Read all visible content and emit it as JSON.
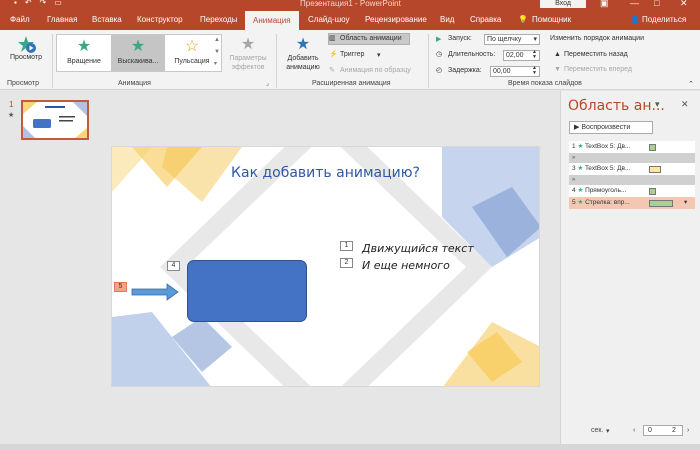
{
  "window": {
    "title": "Презентация1 - PowerPoint",
    "login": "Вход"
  },
  "tabs": [
    "Файл",
    "Главная",
    "Вставка",
    "Конструктор",
    "Переходы",
    "Анимация",
    "Слайд-шоу",
    "Рецензирование",
    "Вид",
    "Справка"
  ],
  "active_tab": "Анимация",
  "tab_right": {
    "help": "Помощник",
    "share": "Поделиться"
  },
  "ribbon": {
    "preview": {
      "label": "Просмотр",
      "group": "Просмотр"
    },
    "gallery": [
      {
        "label": "Вращение",
        "color": "#3aa68a"
      },
      {
        "label": "Выскакива...",
        "color": "#3aa68a"
      },
      {
        "label": "Пульсация",
        "color": "#d9a520"
      }
    ],
    "effect_params": "Параметры эффектов",
    "animation_group": "Анимация",
    "add_animation": "Добавить анимацию",
    "anim_pane": "Область анимации",
    "trigger": "Триггер",
    "painter": "Анимация по образцу",
    "advanced_group": "Расширенная анимация",
    "start_label": "Запуск:",
    "start_value": "По щелчку",
    "duration_label": "Длительность:",
    "duration_value": "02,00",
    "delay_label": "Задержка:",
    "delay_value": "00,00",
    "reorder": "Изменить порядок анимации",
    "move_back": "Переместить назад",
    "move_forward": "Переместить вперед",
    "timing_group": "Время показа слайдов"
  },
  "slide_panel": {
    "number": "1"
  },
  "slide": {
    "title": "Как добавить анимацию?",
    "bullets": [
      {
        "tag": "1",
        "text": "Движущийся текст"
      },
      {
        "tag": "2",
        "text": "И еще немного"
      }
    ],
    "shape_tag": "4",
    "arrow_tag": "5",
    "colors": {
      "blue": "#4472c4",
      "yellow": "#f5c242",
      "lightblue": "#8ea9db"
    }
  },
  "pane": {
    "title": "Область ан...",
    "play": "Воспроизвести",
    "items": [
      {
        "num": "1",
        "label": "TextBox 5: Дв...",
        "swatch": "#a9d18e",
        "selected": false
      },
      {
        "num": "3",
        "label": "TextBox 5: Дв...",
        "swatch": "#ffe699",
        "selected": false
      },
      {
        "num": "4",
        "label": "Прямоуголь...",
        "swatch": "#a9d18e",
        "selected": false
      },
      {
        "num": "5",
        "label": "Стрелка: впр...",
        "swatch": "#a9d18e",
        "selected": true
      }
    ],
    "footer_sec": "сек.",
    "pager_from": "0",
    "pager_to": "2"
  }
}
